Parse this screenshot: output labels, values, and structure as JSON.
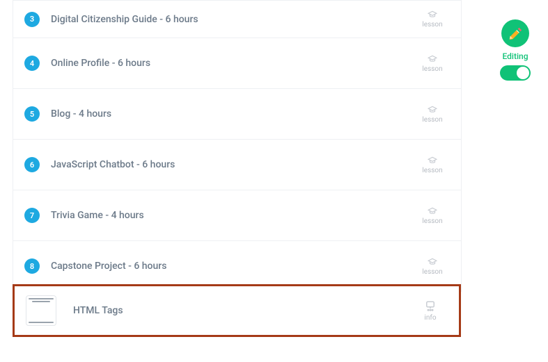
{
  "lessons": [
    {
      "num": "3",
      "title": "Digital Citizenship Guide - 6 hours",
      "type_label": "lesson"
    },
    {
      "num": "4",
      "title": "Online Profile - 6 hours",
      "type_label": "lesson"
    },
    {
      "num": "5",
      "title": "Blog - 4 hours",
      "type_label": "lesson"
    },
    {
      "num": "6",
      "title": "JavaScript Chatbot - 6 hours",
      "type_label": "lesson"
    },
    {
      "num": "7",
      "title": "Trivia Game - 4 hours",
      "type_label": "lesson"
    },
    {
      "num": "8",
      "title": "Capstone Project - 6 hours",
      "type_label": "lesson"
    }
  ],
  "highlighted": {
    "title": "HTML Tags",
    "type_label": "info"
  },
  "editor": {
    "mode_label": "Editing",
    "toggle_on": true
  }
}
